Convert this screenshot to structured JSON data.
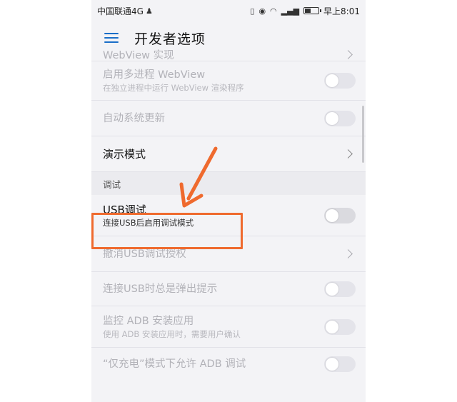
{
  "status_bar": {
    "carrier": "中国联通4G",
    "time": "早上8:01",
    "battery_level": 0.45
  },
  "header": {
    "title": "开发者选项"
  },
  "rows": {
    "webview_impl": {
      "title": "WebView 实现"
    },
    "multiprocess": {
      "title": "启用多进程 WebView",
      "subtitle": "在独立进程中运行 WebView 渲染程序"
    },
    "auto_update": {
      "title": "自动系统更新"
    },
    "demo_mode": {
      "title": "演示模式"
    },
    "usb_debug": {
      "title": "USB调试",
      "subtitle": "连接USB后启用调试模式"
    },
    "revoke_usb": {
      "title": "撤消USB调试授权"
    },
    "usb_prompt": {
      "title": "连接USB时总是弹出提示"
    },
    "adb_monitor": {
      "title": "监控 ADB 安装应用",
      "subtitle": "使用 ADB 安装应用时，需要用户确认"
    },
    "charge_only_adb": {
      "title": "“仅充电”模式下允许 ADB 调试"
    }
  },
  "sections": {
    "debug": "调试"
  },
  "colors": {
    "accent": "#1a6ec8",
    "annotation": "#ef6a2e"
  }
}
